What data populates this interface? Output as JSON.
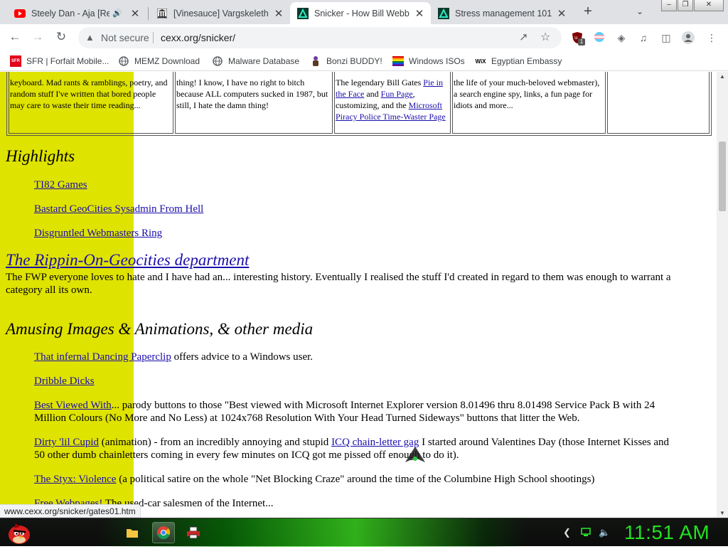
{
  "browser": {
    "tabs": [
      {
        "title": "Steely Dan - Aja [Rem",
        "audio": true
      },
      {
        "title": "[Vinesauce] Vargskelethor"
      },
      {
        "title": "Snicker - How Bill Webb"
      },
      {
        "title": "Stress management 101 -"
      }
    ],
    "new_tab": "+",
    "address": {
      "security_label": "Not secure",
      "url": "cexx.org/snicker/"
    },
    "extension_badge": "1",
    "bookmarks": [
      {
        "label": "SFR | Forfait Mobile...",
        "icon": "sfr-icon",
        "badge": "SFR"
      },
      {
        "label": "MEMZ Download",
        "icon": "globe-icon"
      },
      {
        "label": "Malware Database",
        "icon": "globe-icon"
      },
      {
        "label": "Bonzi BUDDY!",
        "icon": "bonzi-icon"
      },
      {
        "label": "Windows ISOs",
        "icon": "rainbow-flag-icon"
      },
      {
        "label": "Egyptian Embassy",
        "icon": "wix-icon",
        "badge": "WiX"
      }
    ]
  },
  "page": {
    "table_cells": [
      {
        "text": "keyboard. Mad rants & ramblings, poetry, and random stuff I've written that bored people may care to waste their time reading..."
      },
      {
        "text": "thing! I know, I have no right to bitch because ALL computers sucked in 1987, but still, I hate the damn thing!"
      },
      {
        "pre": "The legendary Bill Gates ",
        "link1": "Pie in the Face",
        "mid": " and ",
        "link2": "Fun Page",
        "mid2": ", customizing, and the ",
        "link3": "Microsoft Piracy Police Time-Waster Page"
      },
      {
        "text": "the life of your much-beloved webmaster), a search engine spy, links, a fun page for idiots and more..."
      },
      {
        "text": ""
      }
    ],
    "highlights": {
      "heading": "Highlights",
      "links": [
        "TI82 Games",
        "Bastard GeoCities Sysadmin From Hell",
        "Disgruntled Webmasters Ring"
      ]
    },
    "rippin": {
      "heading": "The Rippin-On-Geocities department",
      "text": "The FWP everyone loves to hate and I have had an... interesting history. Eventually I realised the stuff I'd created in regard to them was enough to warrant a category all its own."
    },
    "amusing": {
      "heading": "Amusing Images & Animations, & other media",
      "items": [
        {
          "link": "That infernal Dancing Paperclip",
          "text": " offers advice to a Windows user."
        },
        {
          "link": "Dribble Dicks",
          "text": ""
        },
        {
          "link": "Best Viewed With",
          "text": "... parody buttons to those \"Best viewed with Microsoft Internet Explorer version 8.01496 thru 8.01498 Service Pack B with 24 Million Colours (No More and No Less) at 1024x768 Resolution With Your Head Turned Sideways\" buttons that litter the Web."
        },
        {
          "link": "Dirty 'lil Cupid",
          "text": " (animation) - from an incredibly annoying and stupid ",
          "link2": "ICQ chain-letter gag",
          "text2": " I started around Valentines Day (those Internet Kisses and 50 other dumb chainletters coming in every few minutes on ICQ got me pissed off enough to do it)."
        },
        {
          "link": "The Styx: Violence",
          "text": " (a political satire on the whole \"Net Blocking Craze\" around the time of the Columbine High School shootings)"
        },
        {
          "link": "Free Webpages!",
          "text": " The used-car salesmen of the Internet..."
        }
      ]
    },
    "status_url": "www.cexx.org/snicker/gates01.htm"
  },
  "taskbar": {
    "clock": "11:51 AM",
    "pinned": [
      {
        "name": "file-explorer-icon"
      },
      {
        "name": "chrome-icon",
        "active": true
      },
      {
        "name": "printer-icon"
      }
    ]
  }
}
